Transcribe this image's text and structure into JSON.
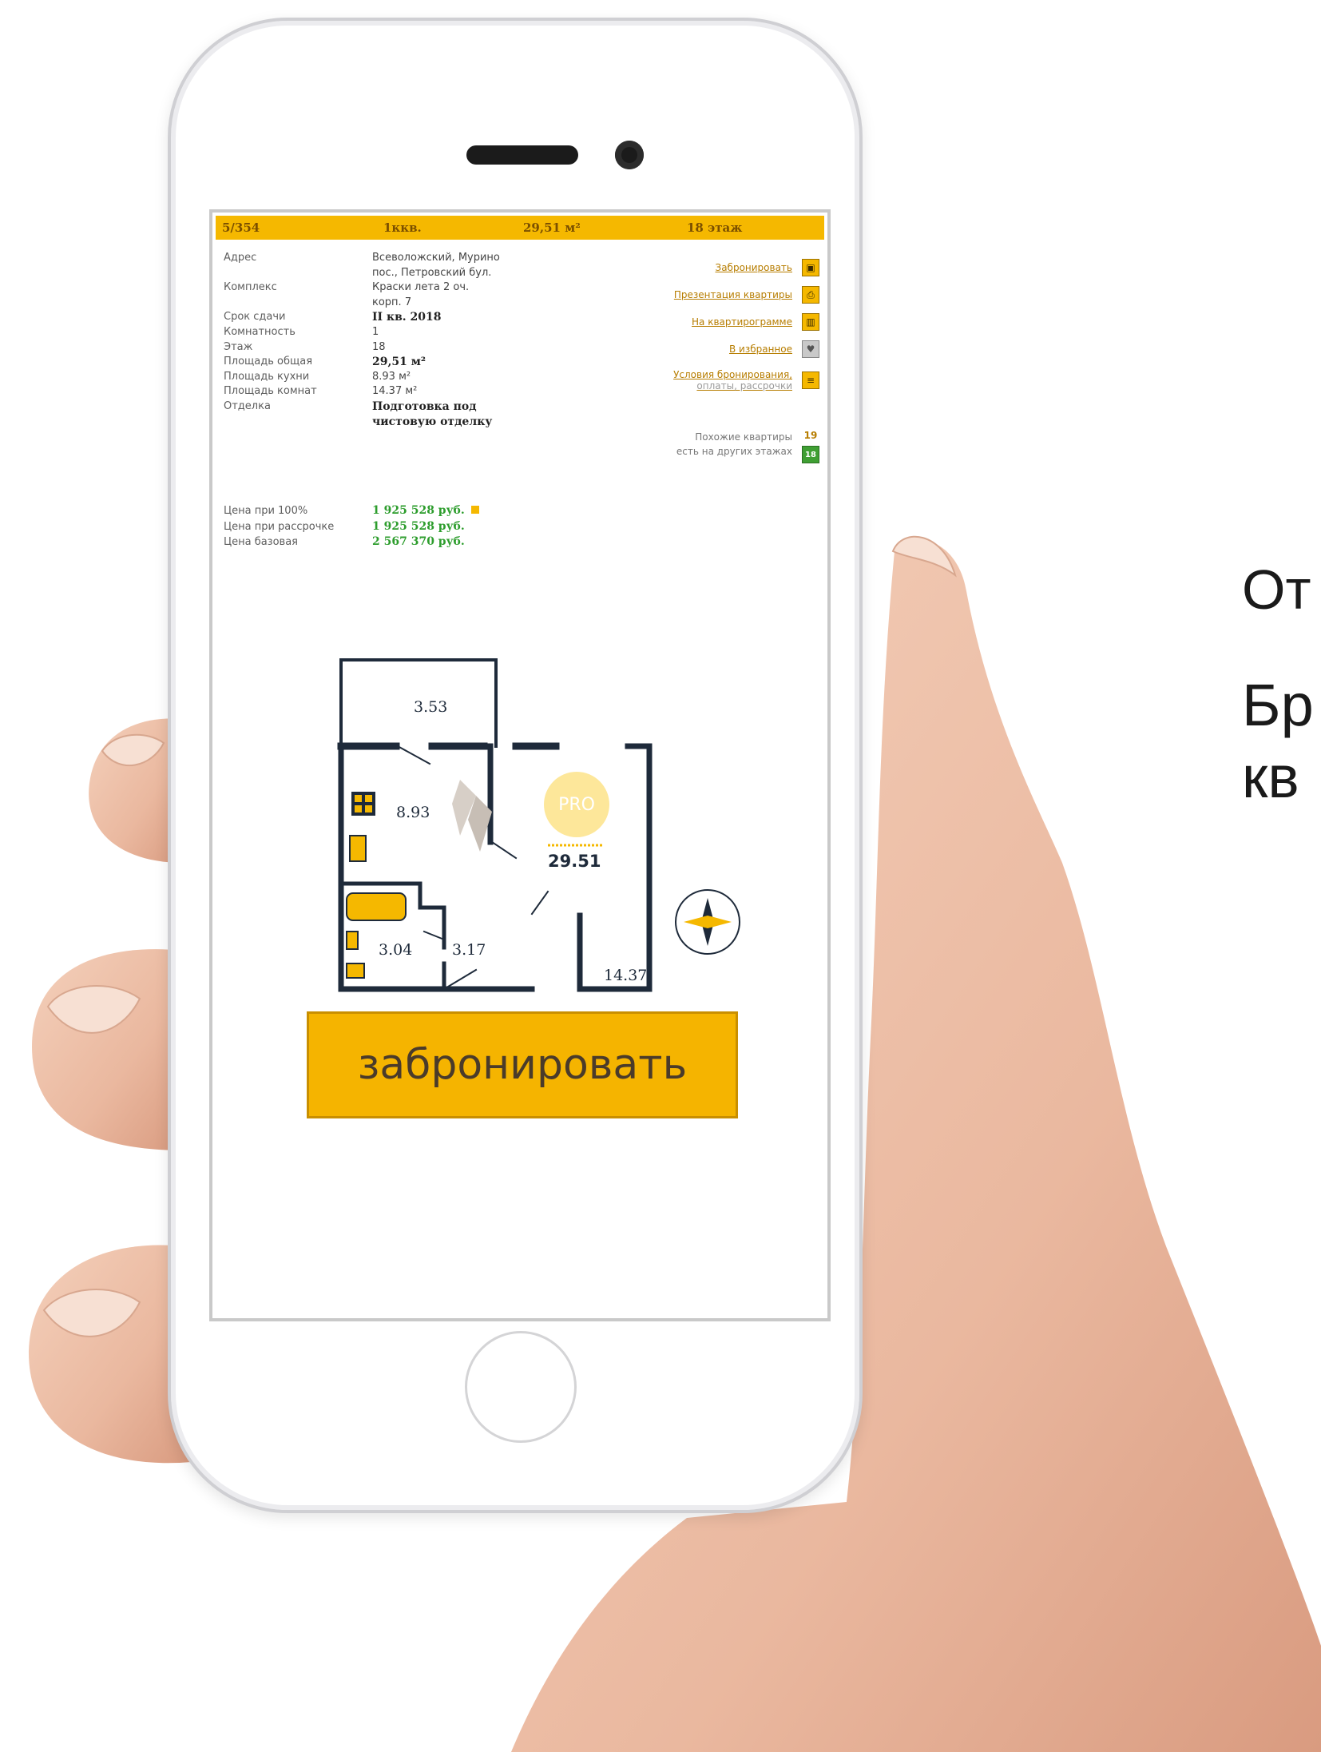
{
  "listing": {
    "id": "5/354",
    "rooms": "1ккв.",
    "area": "29,51 м²",
    "floor": "18 этаж"
  },
  "details": {
    "labels": [
      "Адрес",
      "",
      "Комплекс",
      "",
      "Срок сдачи",
      "Комнатность",
      "Этаж",
      "Площадь общая",
      "Площадь кухни",
      "Площадь комнат",
      "Отделка"
    ],
    "values": {
      "address_1": "Всеволожский, Мурино",
      "address_2": "пос., Петровский бул.",
      "complex_1": "Краски лета 2 оч.",
      "complex_2": "корп. 7",
      "deadline": "II кв. 2018",
      "rooms": "1",
      "floor": "18",
      "total_area": "29,51 м²",
      "kitchen_area": "8.93 м²",
      "room_area": "14.37 м²",
      "finish_1": "Подготовка под",
      "finish_2": "чистовую отделку"
    }
  },
  "actions": {
    "book": "Забронировать",
    "presentation": "Презентация квартиры",
    "on_floor_plan": "На квартирограмме",
    "favorites": "В избранное",
    "conditions_1": "Условия бронирования,",
    "conditions_2": "оплаты, рассрочки",
    "similar_1": "Похожие квартиры",
    "similar_2": "есть на других этажах",
    "similar_count": "19",
    "similar_icon": "18"
  },
  "prices": {
    "full_label": "Цена при 100%",
    "full_value": "1 925 528 руб.",
    "installment_label": "Цена при рассрочке",
    "installment_value": "1 925 528 руб.",
    "base_label": "Цена базовая",
    "base_value": "2 567 370 руб."
  },
  "plan": {
    "balcony": "3.53",
    "kitchen": "8.93",
    "badge": "PRO",
    "total": "29.51",
    "bath": "3.04",
    "hall": "3.17",
    "room": "14.37"
  },
  "book_button": "забронировать",
  "side_text": [
    "От",
    "Бр",
    "кв"
  ],
  "colors": {
    "accent": "#f5b800",
    "price_green": "#2d9d2d",
    "link": "#b77d00",
    "plan_wall": "#1e2a3a"
  }
}
